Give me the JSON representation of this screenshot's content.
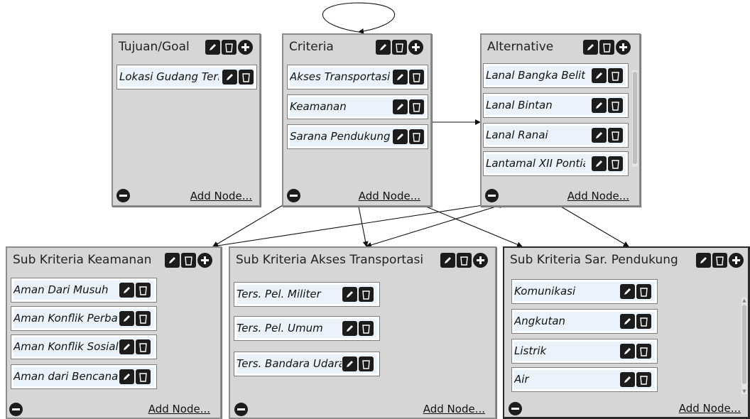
{
  "add_node_label": "Add Node...",
  "icons": {
    "edit": "pencil-icon",
    "delete": "trash-icon",
    "add": "plus-circle-icon",
    "collapse": "minus-circle-icon"
  },
  "nodes": {
    "goal": {
      "title": "Tujuan/Goal",
      "items": [
        "Lokasi Gudang Terb"
      ]
    },
    "criteria": {
      "title": "Criteria",
      "items": [
        "Akses Transportasi",
        "Keamanan",
        "Sarana Pendukung"
      ]
    },
    "alternative": {
      "title": "Alternative",
      "items": [
        "Lanal Bangka Belitu",
        "Lanal Bintan",
        "Lanal Ranai",
        "Lantamal XII Pontia"
      ]
    },
    "sub_keamanan": {
      "title": "Sub Kriteria Keamanan",
      "items": [
        "Aman Dari Musuh",
        "Aman Konflik Perbat",
        "Aman Konflik Sosial",
        "Aman dari Bencana"
      ]
    },
    "sub_akses": {
      "title": "Sub Kriteria Akses Transportasi",
      "items": [
        "Ters. Pel. Militer",
        "Ters. Pel. Umum",
        "Ters. Bandara Udara"
      ]
    },
    "sub_sarana": {
      "title": "Sub Kriteria Sar. Pendukung",
      "items": [
        "Komunikasi",
        "Angkutan",
        "Listrik",
        "Air"
      ]
    }
  }
}
